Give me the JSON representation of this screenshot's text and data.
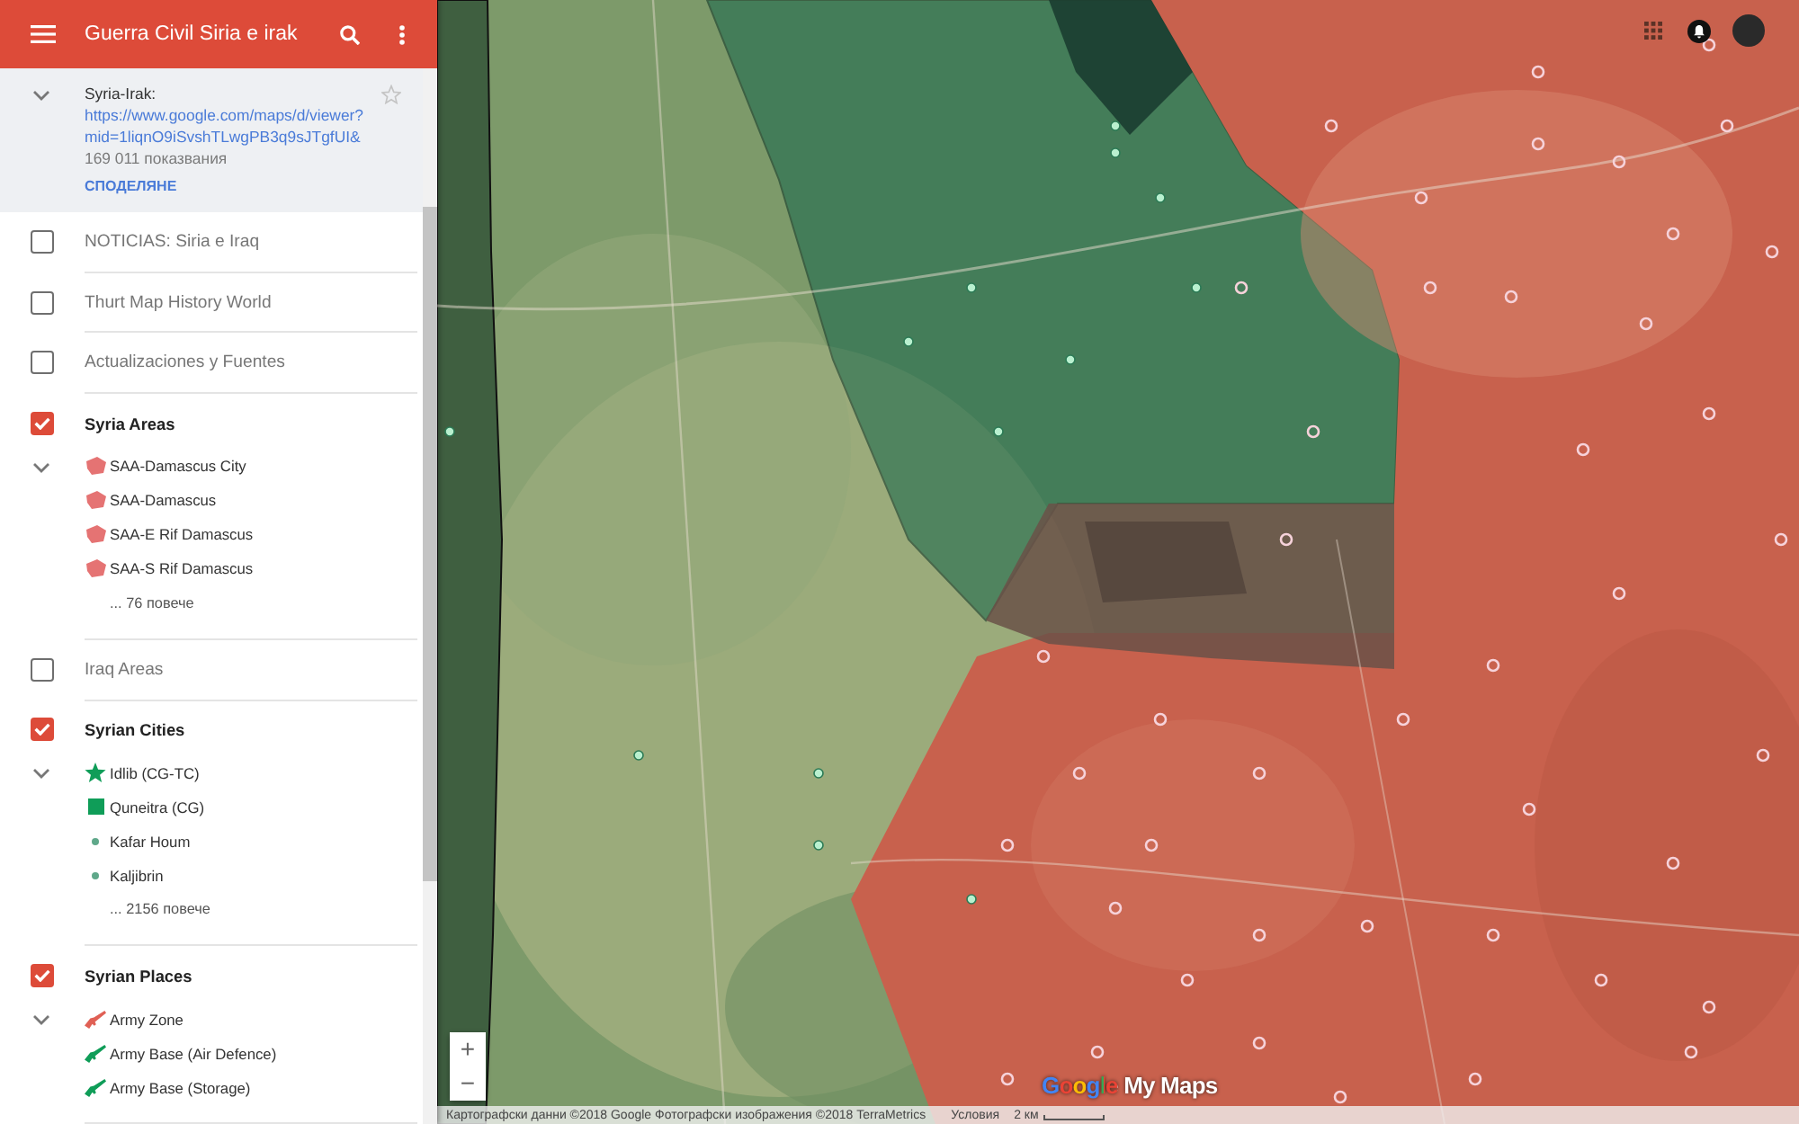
{
  "app_bar": {
    "title": "Guerra Civil Siria e irak"
  },
  "map_info": {
    "name": "Syria-Irak:",
    "url": "https://www.google.com/maps/d/viewer?mid=1liqnO9iSvshTLwgPB3q9sJTgfUI&",
    "views": "169 011 показвания",
    "share": "СПОДЕЛЯНЕ",
    "expanded": true,
    "starred": false
  },
  "layers": [
    {
      "name": "NOTICIAS: Siria e Iraq",
      "checked": false,
      "expanded": false
    },
    {
      "name": "Thurt Map History World",
      "checked": false,
      "expanded": false
    },
    {
      "name": "Actualizaciones y Fuentes",
      "checked": false,
      "expanded": false
    },
    {
      "name": "Syria Areas",
      "checked": true,
      "expanded": true,
      "items": [
        {
          "name": "SAA-Damascus City",
          "kind": "polygon",
          "color": "#e57373"
        },
        {
          "name": "SAA-Damascus",
          "kind": "polygon",
          "color": "#e57373"
        },
        {
          "name": "SAA-E Rif Damascus",
          "kind": "polygon",
          "color": "#e57373"
        },
        {
          "name": "SAA-S Rif Damascus",
          "kind": "polygon",
          "color": "#e57373"
        }
      ],
      "more": "... 76 повече"
    },
    {
      "name": "Iraq Areas",
      "checked": false,
      "expanded": false
    },
    {
      "name": "Syrian Cities",
      "checked": true,
      "expanded": true,
      "items": [
        {
          "name": "Idlib (CG-TC)",
          "kind": "star",
          "color": "#0f9d58"
        },
        {
          "name": "Quneitra (CG)",
          "kind": "square",
          "color": "#0f9d58"
        },
        {
          "name": "Kafar Houm",
          "kind": "dot",
          "color": "#5fa88a"
        },
        {
          "name": "Kaljibrin",
          "kind": "dot",
          "color": "#5fa88a"
        }
      ],
      "more": "... 2156 повече"
    },
    {
      "name": "Syrian Places",
      "checked": true,
      "expanded": true,
      "items": [
        {
          "name": "Army Zone",
          "kind": "rifle",
          "color": "#e06055"
        },
        {
          "name": "Army Base (Air Defence)",
          "kind": "rifle",
          "color": "#0f9d58"
        },
        {
          "name": "Army Base (Storage)",
          "kind": "rifle",
          "color": "#0f9d58"
        }
      ]
    }
  ],
  "map": {
    "zoom_in": "+",
    "zoom_out": "−",
    "logo": "Google My Maps",
    "attribution": "Картографски данни ©2018 Google Фотографски изображения ©2018 TerraMetrics",
    "terms": "Условия",
    "scale": "2 км"
  }
}
